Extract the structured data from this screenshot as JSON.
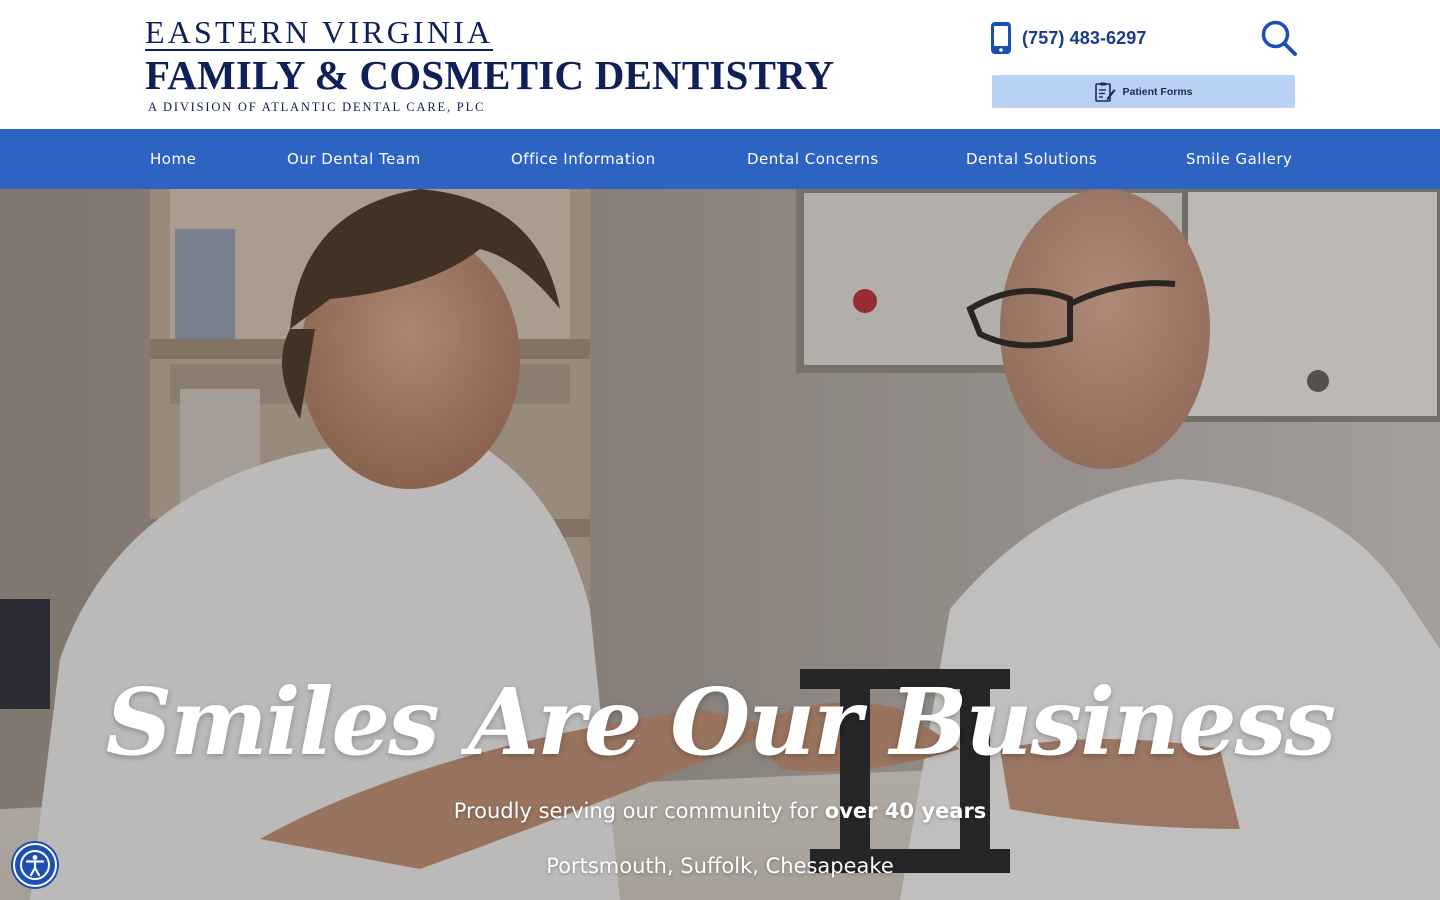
{
  "brand": {
    "line1": "EASTERN VIRGINIA",
    "line2": "FAMILY & COSMETIC DENTISTRY",
    "line3": "A DIVISION OF ATLANTIC DENTAL CARE, PLC",
    "color": "#0f1f57"
  },
  "header": {
    "phone": "(757) 483-6297",
    "phone_icon": "phone-icon",
    "search_icon": "search-icon",
    "patient_forms_label": "Patient Forms",
    "patient_forms_icon": "form-icon"
  },
  "nav": {
    "color": "#2d63c2",
    "items": [
      {
        "label": "Home"
      },
      {
        "label": "Our Dental Team"
      },
      {
        "label": "Office Information"
      },
      {
        "label": "Dental Concerns"
      },
      {
        "label": "Dental Solutions"
      },
      {
        "label": "Smile Gallery"
      }
    ]
  },
  "hero": {
    "title": "Smiles Are Our Business",
    "subtitle_prefix": "Proudly serving our community for ",
    "subtitle_bold": "over 40 years",
    "locations": "Portsmouth, Suffolk, Chesapeake"
  },
  "accessibility": {
    "icon": "accessibility-icon",
    "color": "#1e4fb3"
  }
}
